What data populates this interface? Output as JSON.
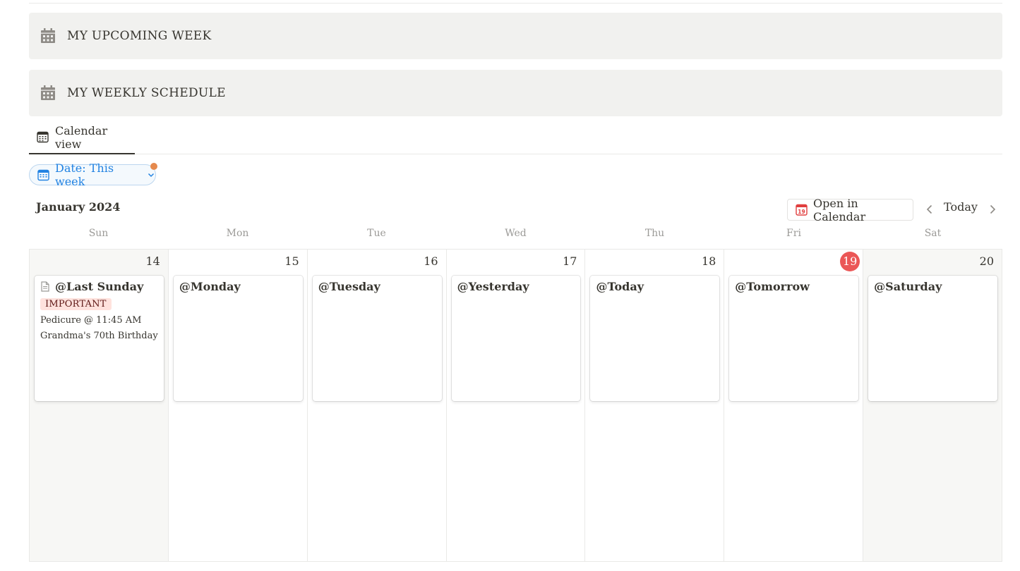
{
  "blocks": [
    {
      "title": "MY UPCOMING WEEK",
      "icon": "calendar-icon"
    },
    {
      "title": "MY WEEKLY SCHEDULE",
      "icon": "calendar-icon"
    }
  ],
  "view_tab": {
    "label": "Calendar view",
    "icon": "calendar-view-icon"
  },
  "filter": {
    "label": "Date: This week",
    "icon": "calendar-icon"
  },
  "calendar": {
    "month_title": "January 2024",
    "open_in_calendar": "Open in Calendar",
    "today_label": "Today",
    "weekdays": [
      "Sun",
      "Mon",
      "Tue",
      "Wed",
      "Thu",
      "Fri",
      "Sat"
    ],
    "days": [
      {
        "num": "14",
        "title": "@Last Sunday",
        "tag": "IMPORTANT",
        "lines": [
          "Pedicure @ 11:45 AM",
          "Grandma's 70th Birthday D"
        ]
      },
      {
        "num": "15",
        "title": "@Monday"
      },
      {
        "num": "16",
        "title": "@Tuesday"
      },
      {
        "num": "17",
        "title": "@Yesterday"
      },
      {
        "num": "18",
        "title": "@Today"
      },
      {
        "num": "19",
        "title": "@Tomorrow",
        "is_today": true
      },
      {
        "num": "20",
        "title": "@Saturday"
      }
    ]
  },
  "colors": {
    "accent_blue": "#2383e2",
    "today_red": "#eb5757",
    "tag_bg": "#ffe2dd",
    "filter_dot": "#e5894d"
  }
}
